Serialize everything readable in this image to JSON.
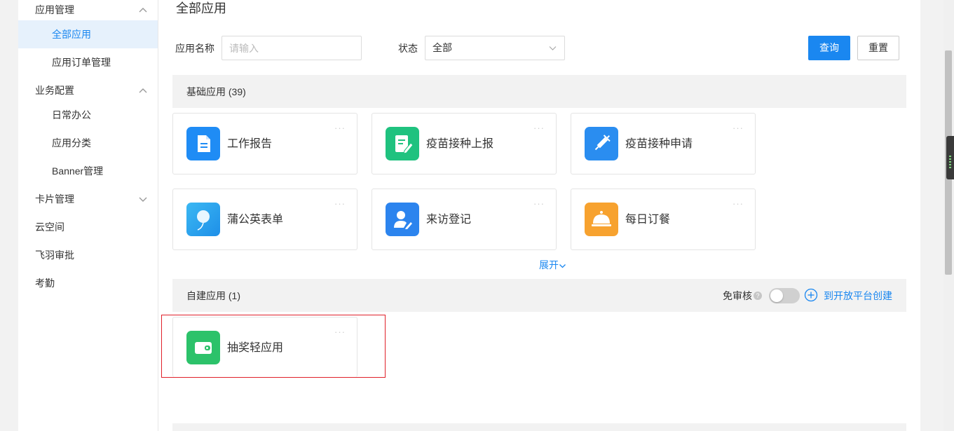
{
  "sidebar": {
    "groups": [
      {
        "label": "应用管理",
        "expanded": true,
        "items": [
          {
            "label": "全部应用",
            "active": true
          },
          {
            "label": "应用订单管理",
            "active": false
          }
        ]
      },
      {
        "label": "业务配置",
        "expanded": true,
        "items": [
          {
            "label": "日常办公",
            "active": false
          },
          {
            "label": "应用分类",
            "active": false
          },
          {
            "label": "Banner管理",
            "active": false
          }
        ]
      },
      {
        "label": "卡片管理",
        "expanded": false,
        "items": []
      },
      {
        "label": "云空间",
        "expanded": null,
        "items": []
      },
      {
        "label": "飞羽审批",
        "expanded": null,
        "items": []
      },
      {
        "label": "考勤",
        "expanded": null,
        "items": []
      }
    ]
  },
  "page": {
    "title": "全部应用"
  },
  "filters": {
    "name_label": "应用名称",
    "name_placeholder": "请输入",
    "name_value": "",
    "status_label": "状态",
    "status_value": "全部",
    "query_button": "查询",
    "reset_button": "重置"
  },
  "basic_apps": {
    "title": "基础应用 (39)",
    "expand_label": "展开",
    "apps": [
      {
        "name": "工作报告",
        "icon": "document-icon",
        "color": "#1f8cf5"
      },
      {
        "name": "疫苗接种上报",
        "icon": "report-pen-icon",
        "color": "#1fc27f"
      },
      {
        "name": "疫苗接种申请",
        "icon": "syringe-icon",
        "color": "#2a8df0"
      },
      {
        "name": "蒲公英表单",
        "icon": "dandelion-icon",
        "color": "#2aa8ee"
      },
      {
        "name": "来访登记",
        "icon": "visitor-icon",
        "color": "#2c84ee"
      },
      {
        "name": "每日订餐",
        "icon": "food-cloche-icon",
        "color": "#f7a22f"
      }
    ],
    "more_glyph": "···"
  },
  "custom_apps": {
    "title": "自建应用 (1)",
    "free_review_label": "免审核",
    "help_glyph": "?",
    "free_review_enabled": false,
    "create_link": "到开放平台创建",
    "apps": [
      {
        "name": "抽奖轻应用",
        "icon": "wallet-icon",
        "color": "#2cc26a"
      }
    ],
    "more_glyph": "···"
  },
  "colors": {
    "primary": "#1a87f0",
    "highlight_border": "#e0202a"
  }
}
